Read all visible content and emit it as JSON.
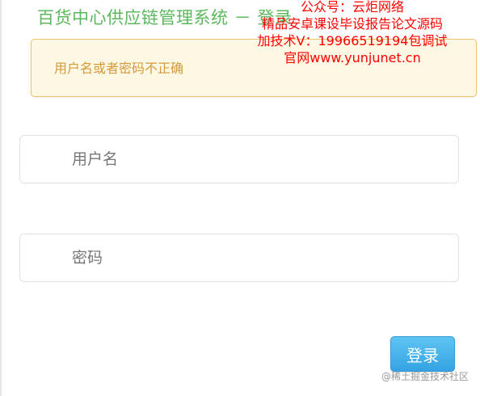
{
  "header": {
    "title": "百货中心供应链管理系统 － 登录"
  },
  "watermark": {
    "lines": [
      "公众号：云炬网络",
      "精品安卓课设毕设报告论文源码",
      "加技术V：19966519194包调试",
      "官网www.yunjunet.cn"
    ]
  },
  "alert": {
    "message": "用户名或者密码不正确"
  },
  "form": {
    "username_placeholder": "用户名",
    "password_placeholder": "密码",
    "login_label": "登录"
  },
  "footer": {
    "credit": "@稀土掘金技术社区"
  },
  "colors": {
    "title": "#5cb85c",
    "alert_background": "#fcf8e3",
    "alert_border": "#f0c36d",
    "alert_text": "#d49a3a",
    "watermark": "#ff0000",
    "button": "#35a3e3"
  }
}
